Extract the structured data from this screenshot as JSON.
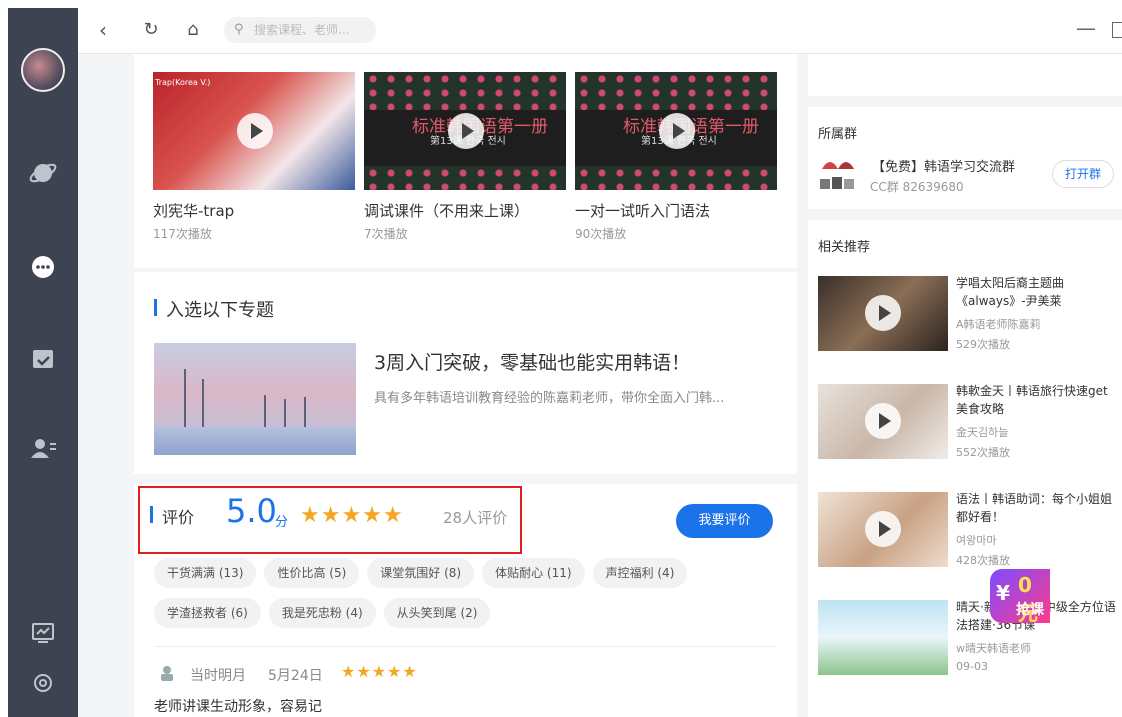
{
  "topbar": {
    "search_placeholder": "搜索课程、老师..."
  },
  "videos": [
    {
      "title": "刘宪华-trap",
      "count": "117次播放",
      "thumb_label": "Trap(Korea V.)"
    },
    {
      "title": "调试课件（不用来上课）",
      "count": "7次播放",
      "thumb_title": "标准韩国语第一册",
      "thumb_sub": "第13课 한국 전시"
    },
    {
      "title": "一对一试听入门语法",
      "count": "90次播放",
      "thumb_title": "标准韩国语第一册",
      "thumb_sub": "第13课 한국 전시"
    }
  ],
  "topics": {
    "section_title": "入选以下专题",
    "title": "3周入门突破，零基础也能实用韩语！",
    "desc": "具有多年韩语培训教育经验的陈嘉莉老师，带你全面入门韩..."
  },
  "rating": {
    "label": "评价",
    "score": "5.0",
    "score_unit": "分",
    "stars": "★★★★★",
    "count": "28人评价",
    "button": "我要评价",
    "tags": [
      "干货满满 (13)",
      "性价比高 (5)",
      "课堂氛围好 (8)",
      "体贴耐心 (11)",
      "声控福利 (4)",
      "学渣拯救者 (6)",
      "我是死忠粉 (4)",
      "从头笑到尾 (2)"
    ],
    "comment": {
      "user": "当时明月",
      "date": "5月24日",
      "stars": "★★★★★",
      "text": "老师讲课生动形象，容易记"
    }
  },
  "group": {
    "label": "所属群",
    "name": "【免费】韩语学习交流群",
    "id": "CC群 82639680",
    "button": "打开群"
  },
  "recommend": {
    "label": "相关推荐",
    "items": [
      {
        "title": "学唱太阳后裔主题曲《always》-尹美莱",
        "author": "A韩语老师陈嘉莉",
        "count": "529次播放"
      },
      {
        "title": "韩軟金天丨韩语旅行快速get美食攻略",
        "author": "金天김하늘",
        "count": "552次播放"
      },
      {
        "title": "语法丨韩语助词：每个小姐姐都好看！",
        "author": "여왕마마",
        "count": "428次播放"
      },
      {
        "title": "晴天·新延世零到中级全方位语法搭建·36节课",
        "author": "w晴天韩语老师",
        "count": "09-03"
      }
    ]
  },
  "promo": {
    "amount": "0元",
    "action": "抢课",
    "symbol": "¥"
  },
  "colors": {
    "accent": "#1a73e8",
    "star": "#f5a623",
    "sidebar": "#3d4351",
    "highlight_box": "#e02020"
  }
}
